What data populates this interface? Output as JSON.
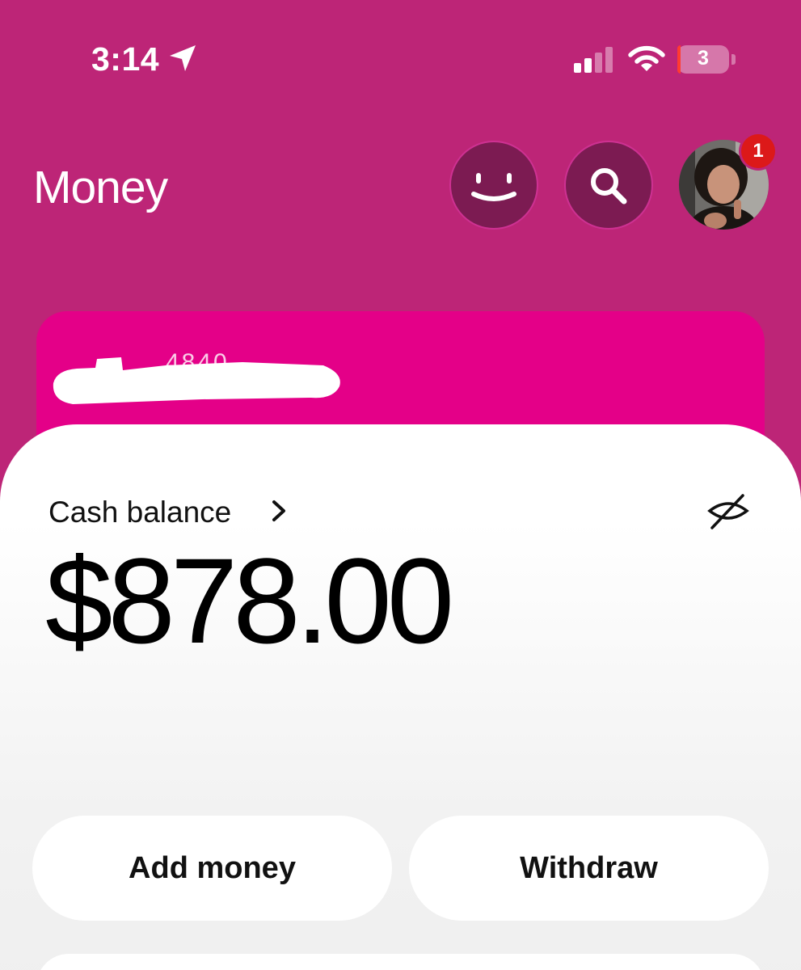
{
  "status_bar": {
    "time": "3:14",
    "battery_level": "3",
    "icons": [
      "location-arrow-icon",
      "cellular-signal-icon",
      "wifi-icon",
      "battery-icon"
    ]
  },
  "header": {
    "title": "Money",
    "buttons": [
      "smiley-icon",
      "search-icon"
    ],
    "notification_count": "1"
  },
  "card": {
    "number_partial": "4840"
  },
  "balance": {
    "label": "Cash balance",
    "amount": "$878.00"
  },
  "actions": {
    "add_money": "Add money",
    "withdraw": "Withdraw"
  },
  "colors": {
    "background": "#bd2577",
    "card": "#e40088",
    "button_dark": "#7c1b52",
    "badge": "#dc1919"
  }
}
